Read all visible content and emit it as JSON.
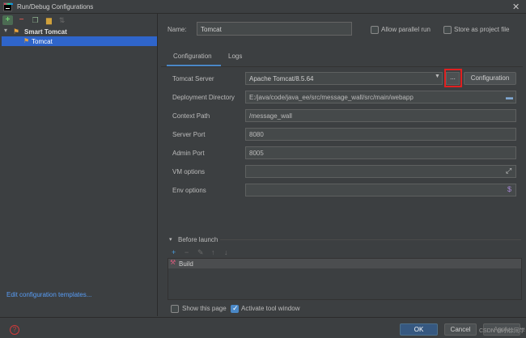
{
  "window": {
    "title": "Run/Debug Configurations",
    "close": "✕"
  },
  "toolbar": {
    "add": "+",
    "remove": "−",
    "copy": "❐",
    "folder": "▆",
    "sort": "⇅"
  },
  "tree": {
    "root_label": "Smart Tomcat",
    "child_label": "Tomcat"
  },
  "left": {
    "edit_templates": "Edit configuration templates..."
  },
  "header": {
    "name_label": "Name:",
    "name_value": "Tomcat",
    "allow_parallel_label": "Allow parallel run",
    "store_as_project_label": "Store as project file"
  },
  "tabs": [
    {
      "label": "Configuration",
      "active": true
    },
    {
      "label": "Logs",
      "active": false
    }
  ],
  "form": {
    "tomcat_server_label": "Tomcat Server",
    "tomcat_server_value": "Apache Tomcat/8.5.64",
    "dots_label": "...",
    "configuration_button": "Configuration",
    "deployment_dir_label": "Deployment Directory",
    "deployment_dir_value": "E:/java/code/java_ee/src/message_wall/src/main/webapp",
    "context_path_label": "Context Path",
    "context_path_value": "/message_wall",
    "server_port_label": "Server Port",
    "server_port_value": "8080",
    "admin_port_label": "Admin Port",
    "admin_port_value": "8005",
    "vm_options_label": "VM options",
    "vm_options_value": "",
    "env_options_label": "Env options",
    "env_options_value": ""
  },
  "before_launch": {
    "title": "Before launch",
    "items": [
      {
        "label": "Build"
      }
    ]
  },
  "footer_checks": {
    "show_this_page_label": "Show this page",
    "show_this_page_checked": false,
    "activate_tool_window_label": "Activate tool window",
    "activate_tool_window_checked": true
  },
  "buttons": {
    "help": "?",
    "ok": "OK",
    "cancel": "Cancel",
    "apply": "Apply"
  },
  "watermark": "CSDN @小徐同学",
  "colors": {
    "accent": "#4a88c7",
    "selection": "#2f65ca",
    "highlight_box": "#e02020",
    "ok_button": "#365880"
  }
}
